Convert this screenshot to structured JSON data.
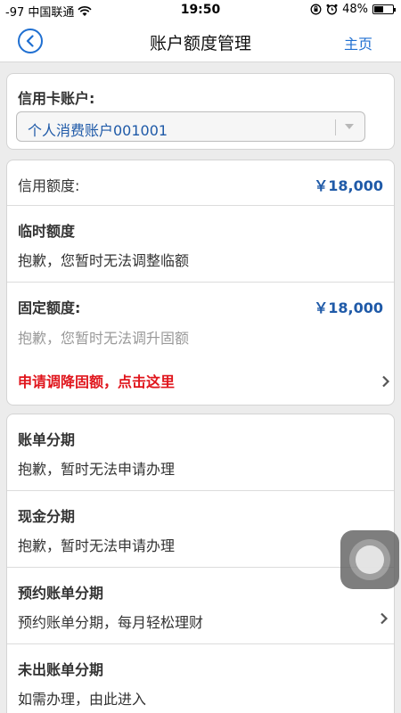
{
  "status_bar": {
    "carrier": "-97 中国联通",
    "time": "19:50",
    "battery_text": "48%",
    "wifi_icon": "wifi-icon",
    "lock_icon": "rotation-lock-icon",
    "alarm_icon": "alarm-icon",
    "battery_level": 0.48
  },
  "nav": {
    "title": "账户额度管理",
    "home": "主页",
    "back_icon": "chevron-left-icon"
  },
  "account_card": {
    "label": "信用卡账户:",
    "selected_account": "个人消费账户001001"
  },
  "limits_card": {
    "credit_limit_label": "信用额度:",
    "credit_limit_value": "￥18,000",
    "temp_limit_label": "临时额度",
    "temp_limit_msg": "抱歉，您暂时无法调整临额",
    "fixed_limit_label": "固定额度:",
    "fixed_limit_value": "￥18,000",
    "fixed_limit_msg": "抱歉，您暂时无法调升固额",
    "reduce_link": "申请调降固额，点击这里"
  },
  "installments_card": {
    "items": [
      {
        "title": "账单分期",
        "desc": "抱歉，暂时无法申请办理",
        "has_chevron": false
      },
      {
        "title": "现金分期",
        "desc": "抱歉，暂时无法申请办理",
        "has_chevron": false
      },
      {
        "title": "预约账单分期",
        "desc": "预约账单分期，每月轻松理财",
        "has_chevron": true
      },
      {
        "title": "未出账单分期",
        "desc": "如需办理，由此进入",
        "has_chevron": false
      }
    ]
  },
  "colors": {
    "accent_blue": "#1f6fd1",
    "amount_blue": "#1f5aa8",
    "warning_red": "#e0151c",
    "background": "#ececec"
  }
}
